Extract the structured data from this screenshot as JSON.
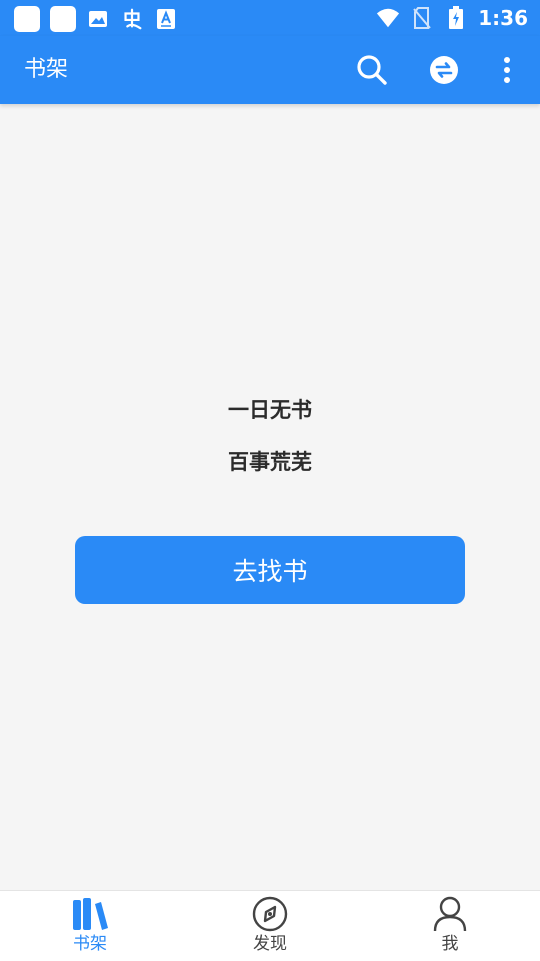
{
  "status_bar": {
    "time": "1:36",
    "left_icons": [
      "app-square-icon",
      "app-square-icon",
      "image-icon",
      "bug-icon",
      "keyboard-a-icon"
    ],
    "right_icons": [
      "wifi-icon",
      "no-sim-icon",
      "battery-charging-icon"
    ]
  },
  "app_bar": {
    "title": "书架",
    "actions": [
      "search-icon",
      "sync-icon",
      "more-vert-icon"
    ]
  },
  "empty_state": {
    "line1": "一日无书",
    "line2": "百事荒芜",
    "button_label": "去找书"
  },
  "bottom_nav": {
    "items": [
      {
        "label": "书架",
        "icon": "bookshelf-icon",
        "active": true
      },
      {
        "label": "发现",
        "icon": "compass-icon",
        "active": false
      },
      {
        "label": "我",
        "icon": "person-icon",
        "active": false
      }
    ]
  },
  "colors": {
    "primary": "#2a8af6",
    "background": "#f5f5f5",
    "text_dark": "#2b2b2b",
    "nav_inactive": "#444444"
  }
}
